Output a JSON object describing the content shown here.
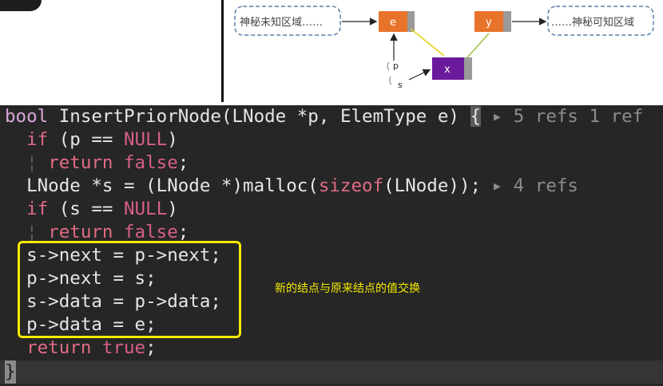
{
  "diagram": {
    "left_cloud": "神秘未知区域……",
    "right_cloud": "……神秘可知区域",
    "node_e": "e",
    "node_y": "y",
    "node_x": "x",
    "pointer_p": "p",
    "pointer_s": "s",
    "colors": {
      "node_e": "#e8732a",
      "node_y": "#e8732a",
      "node_x": "#6a1a9a",
      "arrow_green": "#9ec84a",
      "arrow_yellow": "#e8d21a"
    }
  },
  "code": {
    "line1": {
      "type": "bool",
      "name": "InsertPriorNode",
      "params": "(LNode *p, ElemType e)",
      "brace": "{",
      "hint": "▸ 5 refs 1 ref"
    },
    "line2": {
      "kw": "if",
      "open": " (p == ",
      "const": "NULL",
      "close": ")"
    },
    "line3": {
      "kw": "return",
      "const": "false",
      "end": ";"
    },
    "line4": {
      "pre": "LNode *s = (LNode *)malloc(",
      "fn": "sizeof",
      "post": "(LNode));",
      "hint": "▸ 4 refs"
    },
    "line5": {
      "kw": "if",
      "open": " (s == ",
      "const": "NULL",
      "close": ")"
    },
    "line6": {
      "kw": "return",
      "const": "false",
      "end": ";"
    },
    "line7": "s->next = p->next;",
    "line8": "p->next = s;",
    "line9": "s->data = p->data;",
    "line10": "p->data = e;",
    "line11": {
      "kw": "return",
      "const": "true",
      "end": ";"
    },
    "line12": "}"
  },
  "annotation": "新的结点与原来结点的值交换"
}
